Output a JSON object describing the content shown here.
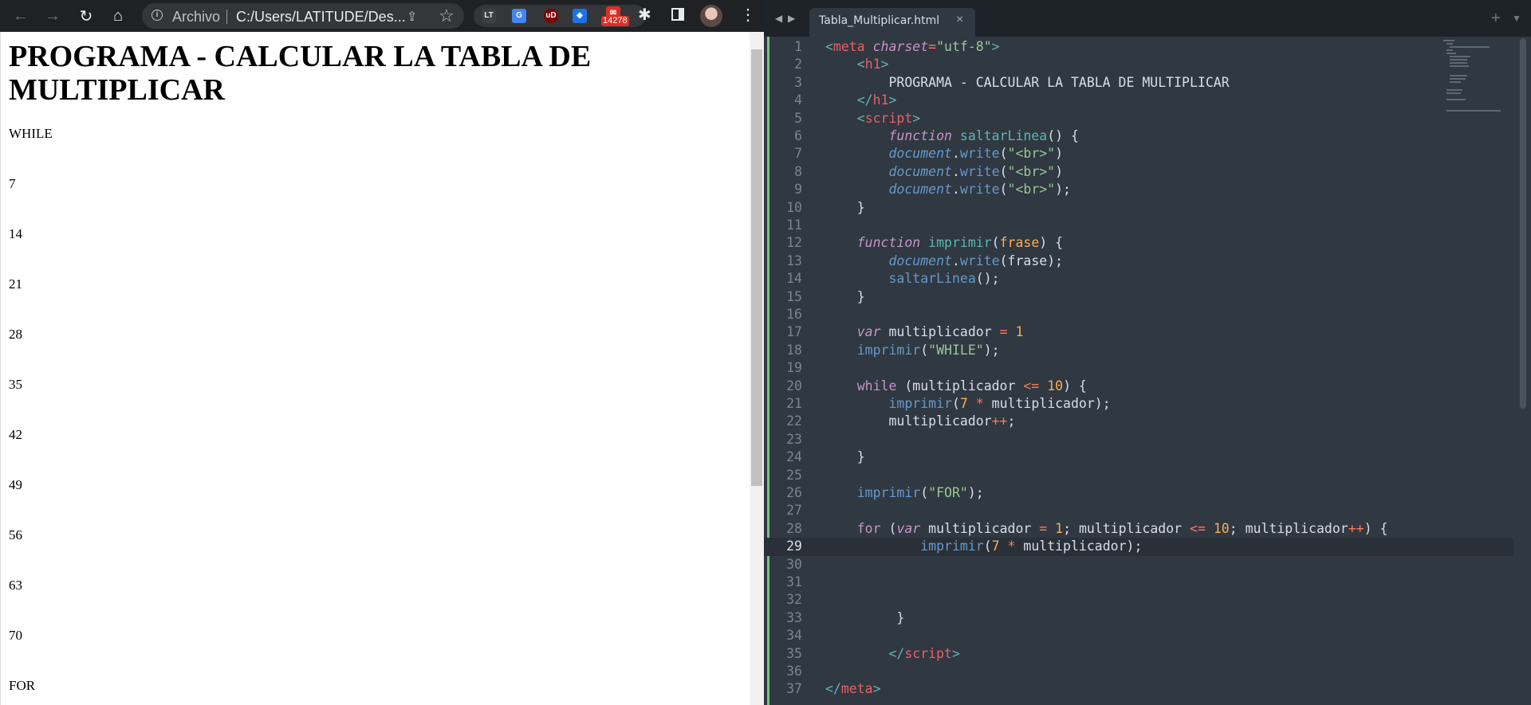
{
  "browser": {
    "omnibox": {
      "label": "Archivo",
      "url": "C:/Users/LATITUDE/Des..."
    },
    "extensions": {
      "mail_badge": "14278"
    },
    "page": {
      "heading": "PROGRAMA - CALCULAR LA TABLA DE MULTIPLICAR",
      "outputs": [
        "WHILE",
        "7",
        "14",
        "21",
        "28",
        "35",
        "42",
        "49",
        "56",
        "63",
        "70",
        "FOR"
      ]
    }
  },
  "editor": {
    "tab_title": "Tabla_Multiplicar.html",
    "current_line": 29,
    "line_numbers": [
      "1",
      "2",
      "3",
      "4",
      "5",
      "6",
      "7",
      "8",
      "9",
      "10",
      "11",
      "12",
      "13",
      "14",
      "15",
      "16",
      "17",
      "18",
      "19",
      "20",
      "21",
      "22",
      "23",
      "24",
      "25",
      "26",
      "27",
      "28",
      "29",
      "30",
      "31",
      "32",
      "33",
      "34",
      "35",
      "36",
      "37"
    ]
  },
  "colors": {
    "browser_chrome": "#202124",
    "editor_bg": "#303841",
    "editor_topbar": "#1e2329",
    "tag": "#5fb4b4",
    "keyword": "#c695c6",
    "string": "#99c794",
    "function": "#6699cc",
    "number": "#f9ae58",
    "operator": "#f97b58"
  },
  "icons": [
    "back-arrow-icon",
    "forward-arrow-icon",
    "reload-icon",
    "home-icon",
    "info-icon",
    "share-icon",
    "star-icon",
    "puzzle-icon",
    "side-panel-icon",
    "menu-dots-icon",
    "close-icon",
    "plus-icon"
  ]
}
